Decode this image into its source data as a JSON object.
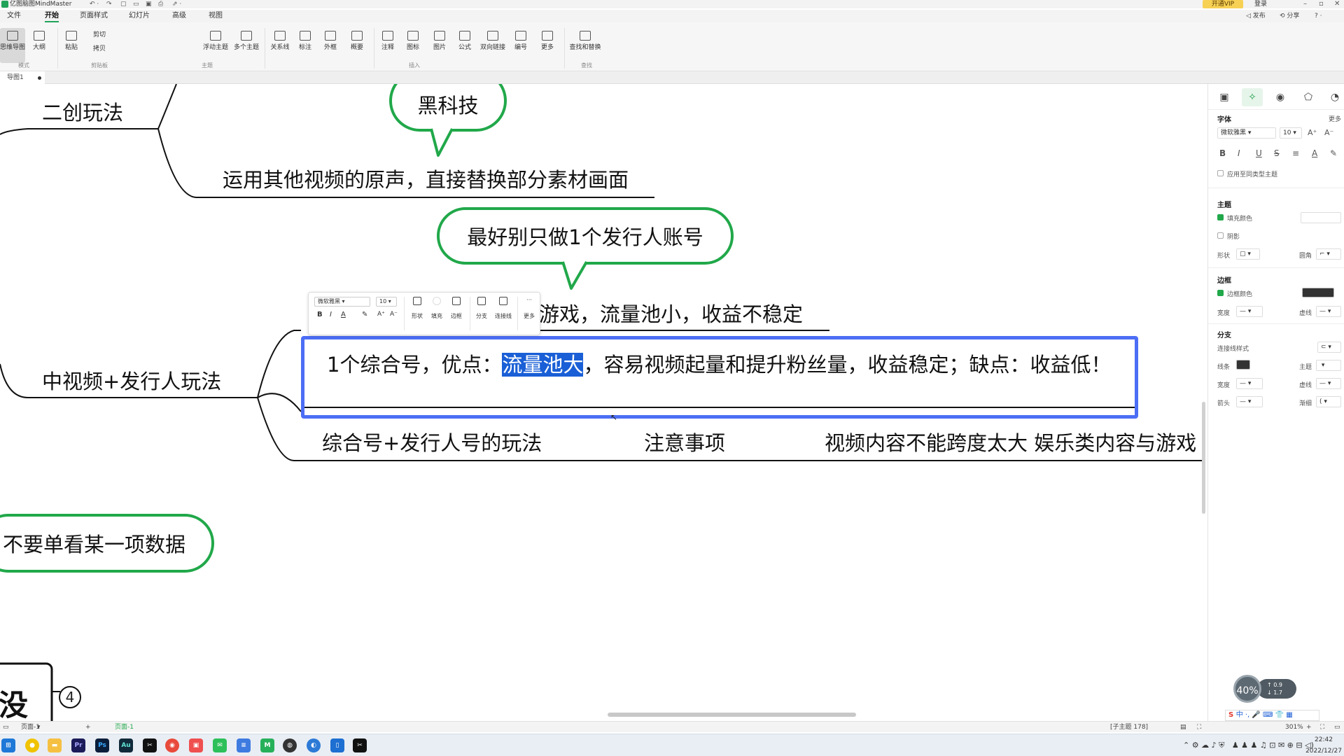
{
  "titlebar": {
    "app_name": "亿图脑图MindMaster",
    "vip": "开通VIP",
    "login": "登录",
    "publish": "发布",
    "share": "分享",
    "help": "?"
  },
  "menu": {
    "tabs": [
      "文件",
      "开始",
      "页面样式",
      "幻灯片",
      "高级",
      "视图"
    ]
  },
  "ribbon": {
    "buttons": {
      "mindmap": "思维导图",
      "outline": "大纲",
      "paste": "粘贴",
      "cut": "剪切",
      "copy": "拷贝",
      "float_topic": "浮动主题",
      "multi_topic": "多个主题",
      "relation": "关系线",
      "callout": "标注",
      "boundary": "外框",
      "summary": "概要",
      "note": "注释",
      "icon": "图标",
      "image": "图片",
      "formula": "公式",
      "bilink": "双向链接",
      "numbering": "编号",
      "more": "更多",
      "find_replace": "查找和替换"
    },
    "groups": {
      "mode": "模式",
      "clipboard": "剪贴板",
      "topic": "主题",
      "insert": "插入",
      "find": "查找"
    }
  },
  "doc_tab": {
    "name": "导图1"
  },
  "canvas": {
    "topics": {
      "remix": "二创玩法",
      "remix_child": "运用其他视频的原声，直接替换部分素材画面",
      "mid_video": "中视频+发行人玩法",
      "behind_toolbar": "游戏，流量池小，收益不稳定",
      "combo": "综合号+发行人号的玩法",
      "notice": "注意事项",
      "content": "视频内容不能跨度太大 娱乐类内容与游戏"
    },
    "callouts": {
      "tech": "黑科技",
      "one_account": "最好别只做1个发行人账号",
      "data": "不要单看某一项数据"
    },
    "selected_topic": {
      "before": "1个综合号，优点：",
      "highlight": "流量池大",
      "after": "，容易视频起量和提升粉丝量，收益稳定；缺点：收益低！"
    },
    "bottom_box_char": "没",
    "bottom_badge": "4"
  },
  "mini_toolbar": {
    "font": "微软雅黑",
    "size": "10",
    "bold": "B",
    "italic": "I",
    "font_color": "A",
    "grow": "A⁺",
    "shrink": "A⁻",
    "shape": "形状",
    "fill": "填充",
    "border": "边框",
    "branch": "分支",
    "connector": "连接线",
    "more": "更多"
  },
  "panel": {
    "font_section": "字体",
    "more": "更多",
    "font_name": "微软雅黑",
    "font_size": "10",
    "apply_same": "应用至同类型主题",
    "theme_section": "主题",
    "fill_color": "填充颜色",
    "shadow": "阴影",
    "shape": "形状",
    "corner": "圆角",
    "border_section": "边框",
    "border_color": "边框颜色",
    "width": "宽度",
    "dash": "虚线",
    "branch_section": "分支",
    "connector_style": "连接线样式",
    "line": "线条",
    "topic": "主题",
    "arrow": "箭头",
    "gradient": "渐细"
  },
  "speed": {
    "percent": "40%",
    "up": "0.9",
    "down": "1.7"
  },
  "status": {
    "page_selector": "页面-1",
    "page_tab": "页面-1",
    "subtopic": "[子主题 178]",
    "zoom": "301%"
  },
  "ime": {
    "text": "中 ·, 🎤 ⌨ 👕 ▦"
  },
  "clock": {
    "time": "22:42",
    "date": "2022/12/27"
  },
  "colors": {
    "accent_green": "#21a84a",
    "selection_blue": "#4c6ef5",
    "highlight_blue": "#1a5fd6"
  }
}
